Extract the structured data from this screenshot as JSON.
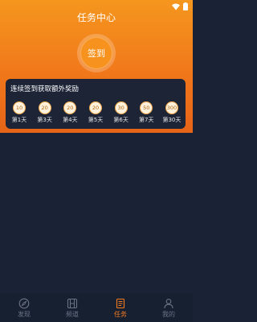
{
  "header": {
    "title": "任务中心",
    "sign_in_label": "签到",
    "accent_color": "#f0741a"
  },
  "status_bar": {
    "icons": [
      "wifi-icon",
      "battery-icon"
    ]
  },
  "bonus_card": {
    "title": "连续签到获取额外奖励",
    "days": [
      {
        "reward": "10",
        "label": "第1天"
      },
      {
        "reward": "20",
        "label": "第3天"
      },
      {
        "reward": "20",
        "label": "第4天"
      },
      {
        "reward": "20",
        "label": "第5天"
      },
      {
        "reward": "30",
        "label": "第6天"
      },
      {
        "reward": "50",
        "label": "第7天"
      },
      {
        "reward": "300",
        "label": "第30天"
      }
    ]
  },
  "tabbar": {
    "active_color": "#f47a1f",
    "items": [
      {
        "label": "发现",
        "icon": "compass-icon"
      },
      {
        "label": "频道",
        "icon": "film-icon"
      },
      {
        "label": "任务",
        "icon": "task-list-icon"
      },
      {
        "label": "我的",
        "icon": "user-icon"
      }
    ]
  }
}
